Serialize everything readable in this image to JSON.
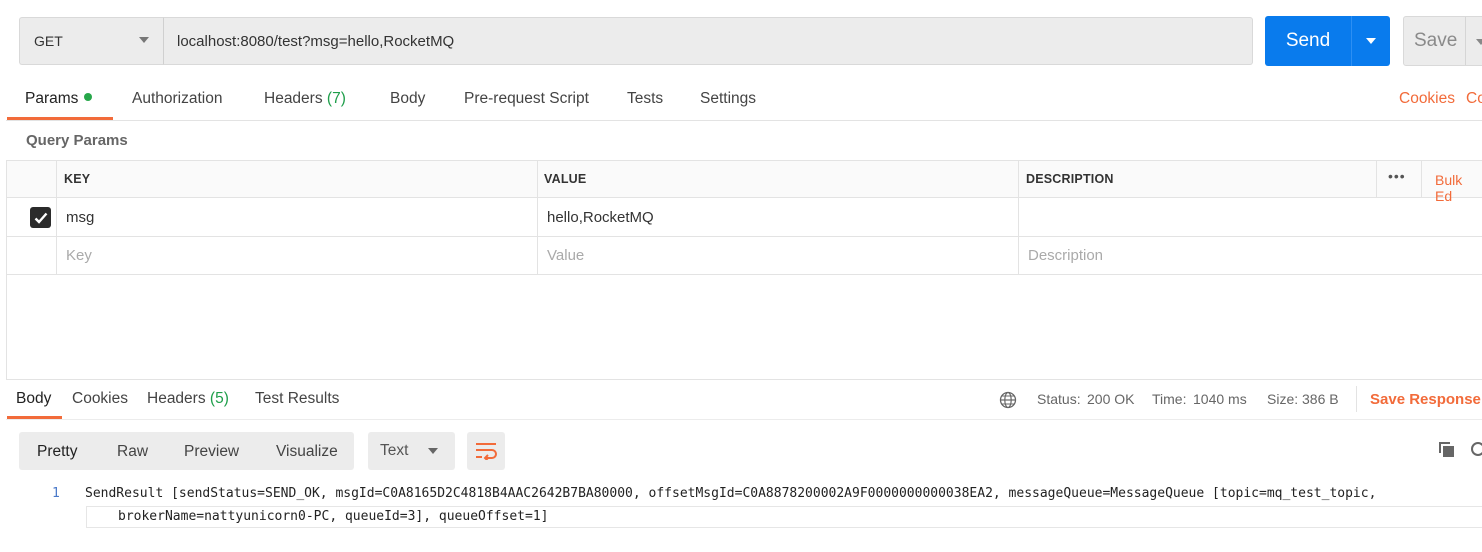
{
  "request": {
    "method": "GET",
    "url": "localhost:8080/test?msg=hello,RocketMQ",
    "send_label": "Send",
    "save_label": "Save"
  },
  "request_tabs": {
    "params": "Params",
    "authorization": "Authorization",
    "headers": "Headers",
    "headers_count": "(7)",
    "body": "Body",
    "prerequest": "Pre-request Script",
    "tests": "Tests",
    "settings": "Settings",
    "cookies": "Cookies",
    "code": "Co"
  },
  "query_params": {
    "title": "Query Params",
    "columns": {
      "key": "KEY",
      "value": "VALUE",
      "description": "DESCRIPTION"
    },
    "more": "•••",
    "bulk_edit": "Bulk Ed",
    "rows": [
      {
        "checked": true,
        "key": "msg",
        "value": "hello,RocketMQ",
        "description": ""
      }
    ],
    "placeholder": {
      "key": "Key",
      "value": "Value",
      "description": "Description"
    }
  },
  "response_tabs": {
    "body": "Body",
    "cookies": "Cookies",
    "headers": "Headers",
    "headers_count": "(5)",
    "test_results": "Test Results"
  },
  "response_meta": {
    "status_label": "Status:",
    "status_value": "200 OK",
    "time_label": "Time:",
    "time_value": "1040 ms",
    "size_label": "Size:",
    "size_value": "386 B",
    "save_response": "Save Response"
  },
  "viewer": {
    "modes": [
      "Pretty",
      "Raw",
      "Preview",
      "Visualize"
    ],
    "format": "Text"
  },
  "response_body": {
    "line_number": "1",
    "line1": "SendResult [sendStatus=SEND_OK, msgId=C0A8165D2C4818B4AAC2642B7BA80000, offsetMsgId=C0A8878200002A9F0000000000038EA2, messageQueue=MessageQueue [topic=mq_test_topic,",
    "line2": "brokerName=nattyunicorn0-PC, queueId=3], queueOffset=1]"
  },
  "colors": {
    "accent": "#f26b3a",
    "send": "#097bed",
    "success": "#1e9e4a"
  }
}
